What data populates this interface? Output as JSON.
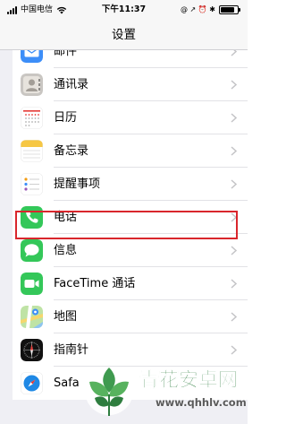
{
  "status_bar": {
    "carrier": "中国电信",
    "time": "下午11:37",
    "right_glyphs": "@ ↗ ⏰ ✱",
    "battery_level": 0.85
  },
  "nav": {
    "title": "设置"
  },
  "settings_items": [
    {
      "label": "邮件",
      "icon": "mail-icon"
    },
    {
      "label": "通讯录",
      "icon": "contacts-icon"
    },
    {
      "label": "日历",
      "icon": "calendar-icon"
    },
    {
      "label": "备忘录",
      "icon": "notes-icon"
    },
    {
      "label": "提醒事项",
      "icon": "reminders-icon"
    },
    {
      "label": "电话",
      "icon": "phone-icon"
    },
    {
      "label": "信息",
      "icon": "messages-icon",
      "highlighted": true
    },
    {
      "label": "FaceTime 通话",
      "icon": "facetime-icon"
    },
    {
      "label": "地图",
      "icon": "maps-icon"
    },
    {
      "label": "指南针",
      "icon": "compass-icon"
    },
    {
      "label": "Safa",
      "icon": "safari-icon"
    }
  ],
  "watermark": {
    "title": "青花安卓网",
    "url": "www.qhhlv.com"
  },
  "colors": {
    "highlight": "#d9262c",
    "phone": "#34c759",
    "messages": "#34c759",
    "facetime": "#34c759",
    "safari": "#1e88e5",
    "mail": "#3d8ef8",
    "watermark": "#2e7d3f"
  }
}
